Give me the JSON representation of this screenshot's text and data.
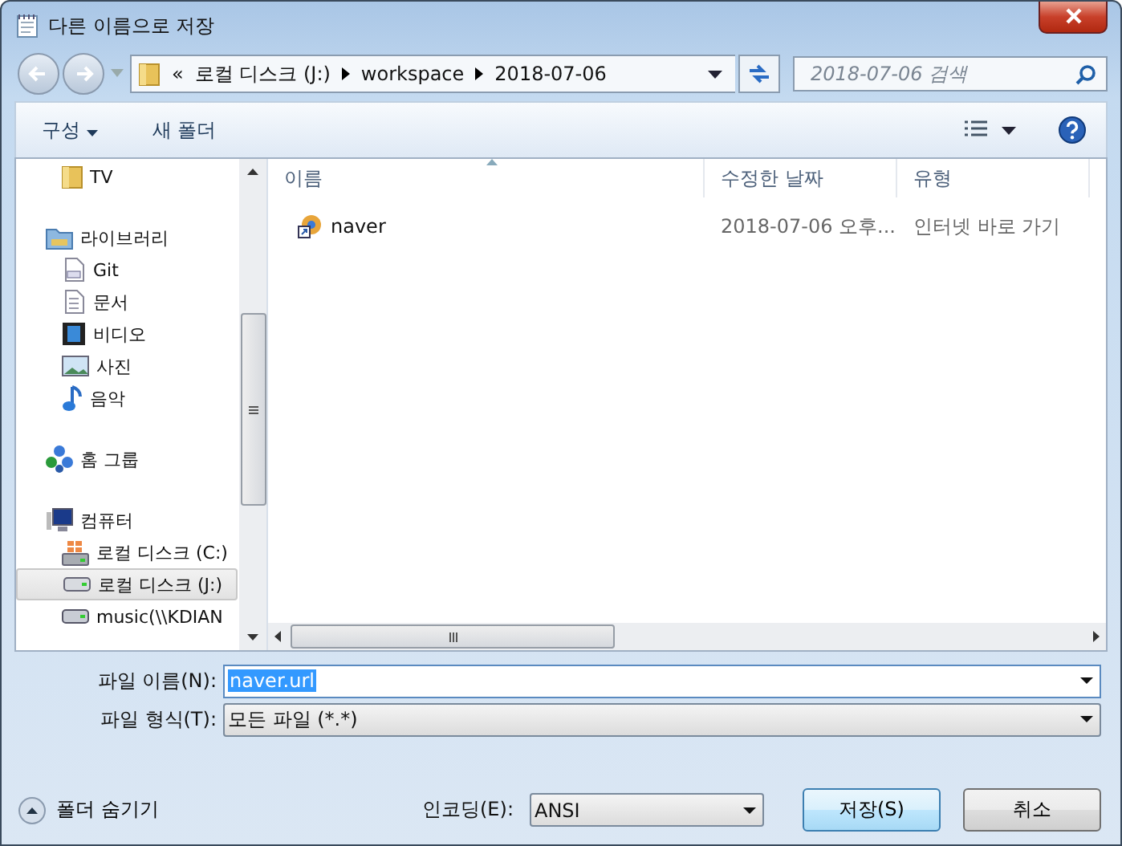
{
  "window": {
    "title": "다른 이름으로 저장"
  },
  "address": {
    "overflow": "«",
    "crumbs": [
      "로컬 디스크 (J:)",
      "workspace",
      "2018-07-06"
    ]
  },
  "search": {
    "placeholder": "2018-07-06 검색"
  },
  "toolbar": {
    "organize": "구성",
    "new_folder": "새 폴더"
  },
  "sidebar": {
    "items": [
      {
        "label": "TV",
        "kind": "folder",
        "selected": false
      },
      {
        "label": "라이브러리",
        "kind": "library",
        "selected": false,
        "children": [
          {
            "label": "Git",
            "kind": "git",
            "selected": false
          },
          {
            "label": "문서",
            "kind": "doc",
            "selected": false
          },
          {
            "label": "비디오",
            "kind": "video",
            "selected": false
          },
          {
            "label": "사진",
            "kind": "photo",
            "selected": false
          },
          {
            "label": "음악",
            "kind": "music",
            "selected": false
          }
        ]
      },
      {
        "label": "홈 그룹",
        "kind": "homegroup",
        "selected": false
      },
      {
        "label": "컴퓨터",
        "kind": "computer",
        "selected": false,
        "children": [
          {
            "label": "로컬 디스크 (C:)",
            "kind": "windrive",
            "selected": false
          },
          {
            "label": "로컬 디스크 (J:)",
            "kind": "drive",
            "selected": true
          },
          {
            "label": "music(\\\\KDIAN",
            "kind": "netdrive",
            "selected": false
          }
        ]
      }
    ]
  },
  "table": {
    "columns": [
      {
        "label": "이름",
        "sorted": true
      },
      {
        "label": "수정한 날짜",
        "sorted": false
      },
      {
        "label": "유형",
        "sorted": false
      }
    ],
    "rows": [
      {
        "name": "naver",
        "modified": "2018-07-06 오후...",
        "type": "인터넷 바로 가기"
      }
    ]
  },
  "file_name": {
    "label": "파일 이름(N):",
    "value": "naver.url"
  },
  "file_type": {
    "label": "파일 형식(T):",
    "value": "모든 파일 (*.*)"
  },
  "hide_folders": "폴더 숨기기",
  "encoding": {
    "label": "인코딩(E):",
    "value": "ANSI"
  },
  "buttons": [
    {
      "label": "저장(S)",
      "kind": "primary"
    },
    {
      "label": "취소",
      "kind": "normal"
    }
  ]
}
